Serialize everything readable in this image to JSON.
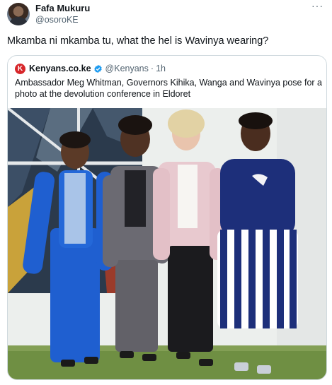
{
  "tweet": {
    "author_name": "Fafa Mukuru",
    "author_handle": "@osoroKE",
    "more_icon": "more-icon",
    "text": "Mkamba ni mkamba tu, what the hel is Wavinya wearing?"
  },
  "quote": {
    "logo_letter": "K",
    "source_name": "Kenyans.co.ke",
    "verified_icon": "verified-badge-icon",
    "source_handle": "@Kenyans",
    "dot": "·",
    "time": "1h",
    "text": "Ambassador Meg Whitman, Governors Kihika, Wanga and Wavinya pose for a photo at the devolution conference in Eldoret"
  },
  "photo": {
    "description_icon": "photo",
    "colors": {
      "tent": "#eef0ee",
      "grass": "#6f8f43",
      "blue_suit": "#1f5fd0",
      "grey_suit": "#6b6a72",
      "pink_jacket": "#e8c9cf",
      "navy_top": "#1d2f7a"
    }
  }
}
